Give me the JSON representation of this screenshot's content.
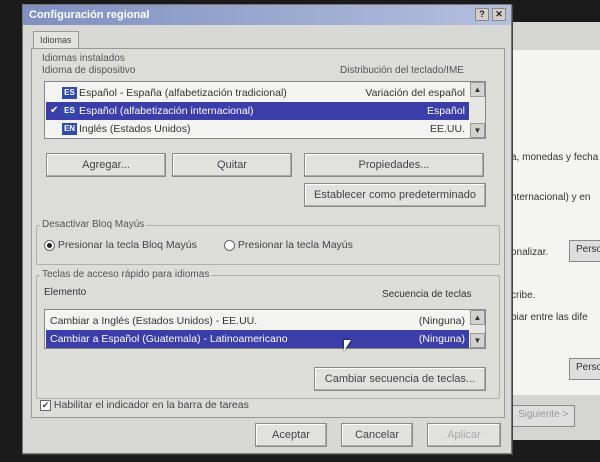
{
  "window": {
    "title": "Configuración regional"
  },
  "tabs": [
    {
      "label": "Idiomas"
    }
  ],
  "installed": {
    "group_label": "Idiomas instalados",
    "col_device": "Idioma de dispositivo",
    "col_layout": "Distribución del teclado/IME",
    "rows": [
      {
        "code": "ES",
        "name": "Español - España (alfabetización tradicional)",
        "layout": "Variación del español",
        "checked": ""
      },
      {
        "code": "ES",
        "name": "Español (alfabetización internacional)",
        "layout": "Español",
        "checked": "✔"
      },
      {
        "code": "EN",
        "name": "Inglés (Estados Unidos)",
        "layout": "EE.UU.",
        "checked": ""
      }
    ]
  },
  "buttons": {
    "add": "Agregar...",
    "remove": "Quitar",
    "properties": "Propiedades...",
    "set_default": "Establecer como predeterminado",
    "change_sequence": "Cambiar secuencia de teclas...",
    "ok": "Aceptar",
    "cancel": "Cancelar",
    "apply": "Aplicar"
  },
  "capslock": {
    "group_label": "Desactivar Bloq Mayús",
    "opt_capslock": "Presionar la tecla Bloq Mayús",
    "opt_shift": "Presionar la tecla Mayús"
  },
  "hotkeys": {
    "group_label": "Teclas de acceso rápido para idiomas",
    "col_item": "Elemento",
    "col_sequence": "Secuencia de teclas",
    "rows": [
      {
        "item": "Cambiar a Inglés (Estados Unidos) - EE.UU.",
        "sequence": "(Ninguna)"
      },
      {
        "item": "Cambiar a Español (Guatemala) - Latinoamericano",
        "sequence": "(Ninguna)"
      }
    ]
  },
  "taskbar_indicator": {
    "label": "Habilitar el indicador en la barra de tareas",
    "check": "✔"
  },
  "background": {
    "text1": "a, monedas y fecha",
    "text2": "nternacional) y en",
    "text3": "onalizar.",
    "btn1": "Perso",
    "text4": "cribe.",
    "text5": "biar entre las dife",
    "btn2": "Perso",
    "btn3": "Siguiente >"
  },
  "colors": {
    "selection": "#3b3da8",
    "title_gradient_start": "#7f8fc0"
  }
}
